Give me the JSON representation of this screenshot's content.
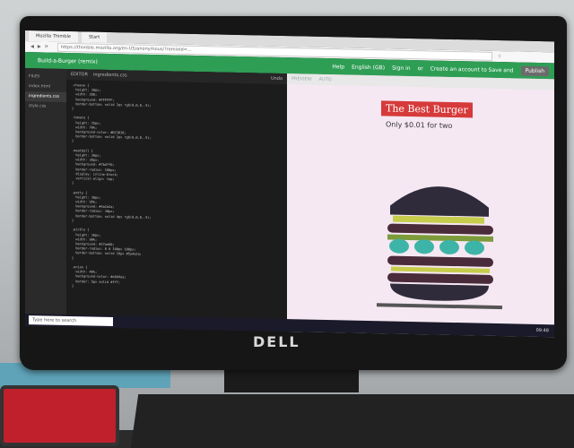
{
  "browser": {
    "tabs": [
      "Mozilla Thimble",
      "Start"
    ],
    "url": "https://thimble.mozilla.org/en-US/anonymous/?remixId=...",
    "project_title": "Build-a-Burger (remix)",
    "menu_help": "Help",
    "menu_lang": "English (GB)",
    "signin": "Sign in",
    "or_text": "or",
    "create_account": "Create an account to Save and",
    "publish": "Publish"
  },
  "sidebar": {
    "header": "FILES",
    "items": [
      "index.html",
      "ingredients.css",
      "style.css"
    ]
  },
  "editor": {
    "header": "EDITOR",
    "filename": "ingredients.css",
    "undo": "Undo",
    "code": ".cheese {\n  height: 30px;\n  width: 280;\n  background: #FFFFFF;\n  border-bottom: solid 2px rgb(0,0,0,.5);\n}\n\n.tomato {\n  height: 25px;\n  width: 70%;\n  background-color: #DC3030;\n  border-bottom: solid 2px rgb(0,0,0,.5);\n}\n\n.meatball {\n  height: 30px;\n  width: 30px;\n  background: #7bd7f9;\n  border-radius: 100px;\n  display: inline-block;\n  vertical-align: top;\n}\n\n.patty {\n  height: 30px;\n  width: 95%;\n  background: #4a2a2a;\n  border-radius: 30px;\n  border-bottom: solid 4px rgb(0,0,0,.5);\n}\n\n.pickle {\n  height: 30px;\n  width: 90%;\n  background: #27ae60;\n  border-radius: 0 0 100px 100px;\n  border-bottom: solid 10px #5a4a2a;\n}\n\n.onion {\n  width: 40%;\n  background-color: #e8d4ea;\n  border: 5px solid #fff;\n}"
  },
  "preview": {
    "header": "PREVIEW",
    "auto": "AUTO",
    "title": "The Best Burger",
    "subtitle": "Only $0.01 for two"
  },
  "taskbar": {
    "search_placeholder": "Type here to search",
    "clock": "09:48"
  },
  "monitor": {
    "brand": "DELL"
  }
}
